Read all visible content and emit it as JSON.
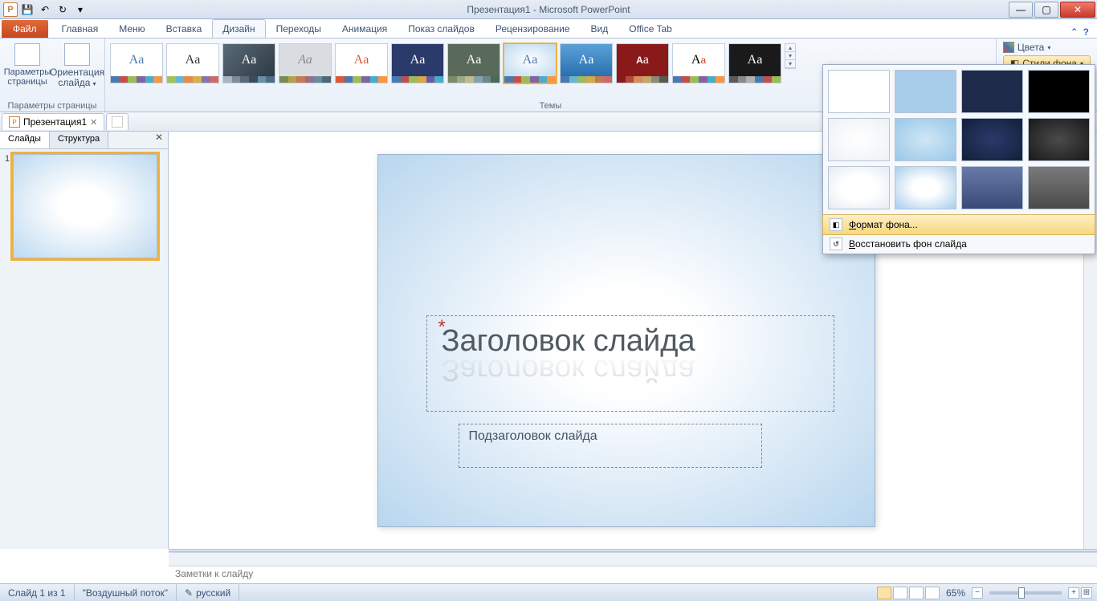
{
  "window": {
    "title": "Презентация1 - Microsoft PowerPoint",
    "app_icon": "P"
  },
  "ribbon": {
    "file": "Файл",
    "tabs": [
      "Главная",
      "Меню",
      "Вставка",
      "Дизайн",
      "Переходы",
      "Анимация",
      "Показ слайдов",
      "Рецензирование",
      "Вид",
      "Office Tab"
    ],
    "active_tab": "Дизайн",
    "groups": {
      "page_setup": {
        "label": "Параметры страницы",
        "btn1": "Параметры страницы",
        "btn2": "Ориентация слайда"
      },
      "themes": {
        "label": "Темы"
      }
    },
    "right": {
      "colors": "Цвета",
      "styles_btn": "Стили фона"
    }
  },
  "doc_tabs": {
    "name": "Презентация1"
  },
  "left_pane": {
    "tab1": "Слайды",
    "tab2": "Структура",
    "slide_num": "1"
  },
  "slide": {
    "title": "Заголовок слайда",
    "subtitle": "Подзаголовок слайда"
  },
  "notes": {
    "placeholder": "Заметки к слайду"
  },
  "status": {
    "slide": "Слайд 1 из 1",
    "theme": "\"Воздушный поток\"",
    "lang": "русский",
    "zoom": "65%"
  },
  "bg_panel": {
    "format": "Формат фона...",
    "restore": "Восстановить фон слайда"
  }
}
